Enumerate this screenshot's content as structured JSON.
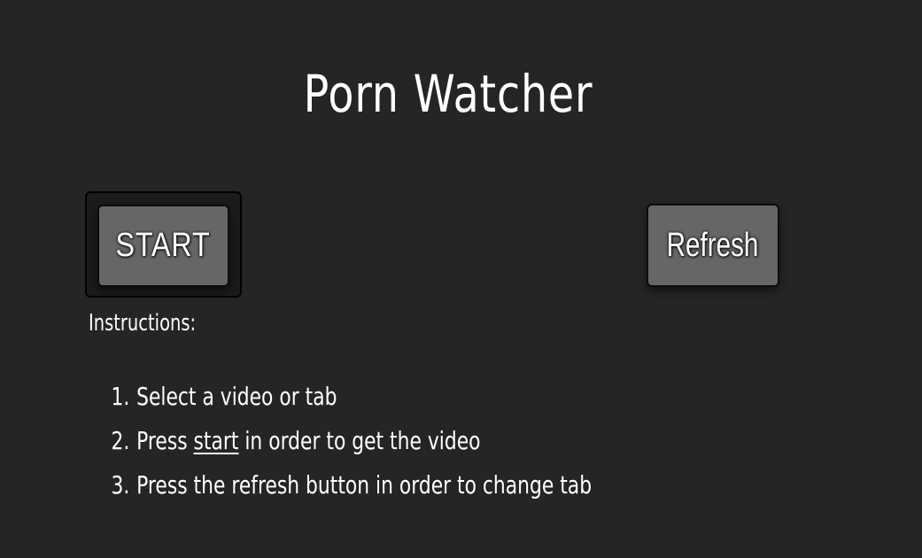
{
  "page": {
    "title": "Porn Watcher"
  },
  "buttons": {
    "start_label": "START",
    "refresh_label": "Refresh"
  },
  "instructions": {
    "label": "Instructions:",
    "steps": [
      {
        "number": "1.",
        "text": "Select a video or tab"
      },
      {
        "number": "2.",
        "before": "Press ",
        "link": "start",
        "after": " in order to get the video"
      },
      {
        "number": "3.",
        "text": "Press the refresh button in order to change tab"
      }
    ]
  },
  "colors": {
    "background": "#252525",
    "button": "#666666",
    "text": "#ffffff"
  }
}
